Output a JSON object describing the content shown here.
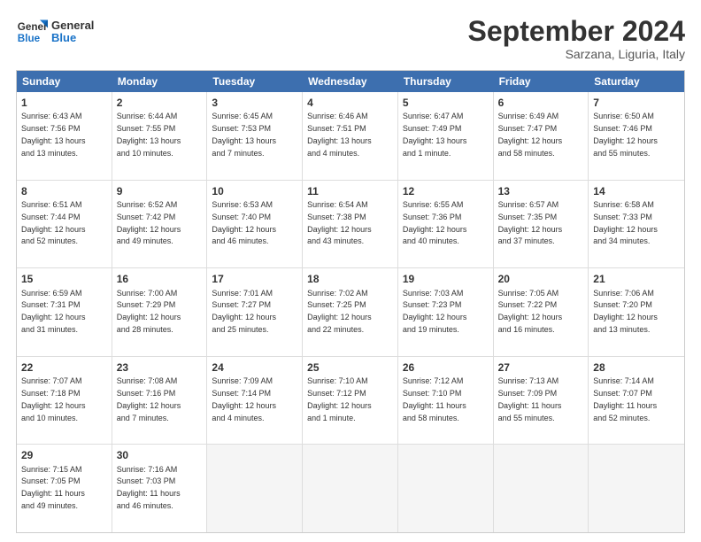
{
  "logo": {
    "line1": "General",
    "line2": "Blue"
  },
  "title": "September 2024",
  "location": "Sarzana, Liguria, Italy",
  "header_days": [
    "Sunday",
    "Monday",
    "Tuesday",
    "Wednesday",
    "Thursday",
    "Friday",
    "Saturday"
  ],
  "weeks": [
    [
      {
        "day": "1",
        "info": "Sunrise: 6:43 AM\nSunset: 7:56 PM\nDaylight: 13 hours\nand 13 minutes."
      },
      {
        "day": "2",
        "info": "Sunrise: 6:44 AM\nSunset: 7:55 PM\nDaylight: 13 hours\nand 10 minutes."
      },
      {
        "day": "3",
        "info": "Sunrise: 6:45 AM\nSunset: 7:53 PM\nDaylight: 13 hours\nand 7 minutes."
      },
      {
        "day": "4",
        "info": "Sunrise: 6:46 AM\nSunset: 7:51 PM\nDaylight: 13 hours\nand 4 minutes."
      },
      {
        "day": "5",
        "info": "Sunrise: 6:47 AM\nSunset: 7:49 PM\nDaylight: 13 hours\nand 1 minute."
      },
      {
        "day": "6",
        "info": "Sunrise: 6:49 AM\nSunset: 7:47 PM\nDaylight: 12 hours\nand 58 minutes."
      },
      {
        "day": "7",
        "info": "Sunrise: 6:50 AM\nSunset: 7:46 PM\nDaylight: 12 hours\nand 55 minutes."
      }
    ],
    [
      {
        "day": "8",
        "info": "Sunrise: 6:51 AM\nSunset: 7:44 PM\nDaylight: 12 hours\nand 52 minutes."
      },
      {
        "day": "9",
        "info": "Sunrise: 6:52 AM\nSunset: 7:42 PM\nDaylight: 12 hours\nand 49 minutes."
      },
      {
        "day": "10",
        "info": "Sunrise: 6:53 AM\nSunset: 7:40 PM\nDaylight: 12 hours\nand 46 minutes."
      },
      {
        "day": "11",
        "info": "Sunrise: 6:54 AM\nSunset: 7:38 PM\nDaylight: 12 hours\nand 43 minutes."
      },
      {
        "day": "12",
        "info": "Sunrise: 6:55 AM\nSunset: 7:36 PM\nDaylight: 12 hours\nand 40 minutes."
      },
      {
        "day": "13",
        "info": "Sunrise: 6:57 AM\nSunset: 7:35 PM\nDaylight: 12 hours\nand 37 minutes."
      },
      {
        "day": "14",
        "info": "Sunrise: 6:58 AM\nSunset: 7:33 PM\nDaylight: 12 hours\nand 34 minutes."
      }
    ],
    [
      {
        "day": "15",
        "info": "Sunrise: 6:59 AM\nSunset: 7:31 PM\nDaylight: 12 hours\nand 31 minutes."
      },
      {
        "day": "16",
        "info": "Sunrise: 7:00 AM\nSunset: 7:29 PM\nDaylight: 12 hours\nand 28 minutes."
      },
      {
        "day": "17",
        "info": "Sunrise: 7:01 AM\nSunset: 7:27 PM\nDaylight: 12 hours\nand 25 minutes."
      },
      {
        "day": "18",
        "info": "Sunrise: 7:02 AM\nSunset: 7:25 PM\nDaylight: 12 hours\nand 22 minutes."
      },
      {
        "day": "19",
        "info": "Sunrise: 7:03 AM\nSunset: 7:23 PM\nDaylight: 12 hours\nand 19 minutes."
      },
      {
        "day": "20",
        "info": "Sunrise: 7:05 AM\nSunset: 7:22 PM\nDaylight: 12 hours\nand 16 minutes."
      },
      {
        "day": "21",
        "info": "Sunrise: 7:06 AM\nSunset: 7:20 PM\nDaylight: 12 hours\nand 13 minutes."
      }
    ],
    [
      {
        "day": "22",
        "info": "Sunrise: 7:07 AM\nSunset: 7:18 PM\nDaylight: 12 hours\nand 10 minutes."
      },
      {
        "day": "23",
        "info": "Sunrise: 7:08 AM\nSunset: 7:16 PM\nDaylight: 12 hours\nand 7 minutes."
      },
      {
        "day": "24",
        "info": "Sunrise: 7:09 AM\nSunset: 7:14 PM\nDaylight: 12 hours\nand 4 minutes."
      },
      {
        "day": "25",
        "info": "Sunrise: 7:10 AM\nSunset: 7:12 PM\nDaylight: 12 hours\nand 1 minute."
      },
      {
        "day": "26",
        "info": "Sunrise: 7:12 AM\nSunset: 7:10 PM\nDaylight: 11 hours\nand 58 minutes."
      },
      {
        "day": "27",
        "info": "Sunrise: 7:13 AM\nSunset: 7:09 PM\nDaylight: 11 hours\nand 55 minutes."
      },
      {
        "day": "28",
        "info": "Sunrise: 7:14 AM\nSunset: 7:07 PM\nDaylight: 11 hours\nand 52 minutes."
      }
    ],
    [
      {
        "day": "29",
        "info": "Sunrise: 7:15 AM\nSunset: 7:05 PM\nDaylight: 11 hours\nand 49 minutes."
      },
      {
        "day": "30",
        "info": "Sunrise: 7:16 AM\nSunset: 7:03 PM\nDaylight: 11 hours\nand 46 minutes."
      },
      {
        "day": "",
        "info": ""
      },
      {
        "day": "",
        "info": ""
      },
      {
        "day": "",
        "info": ""
      },
      {
        "day": "",
        "info": ""
      },
      {
        "day": "",
        "info": ""
      }
    ]
  ]
}
